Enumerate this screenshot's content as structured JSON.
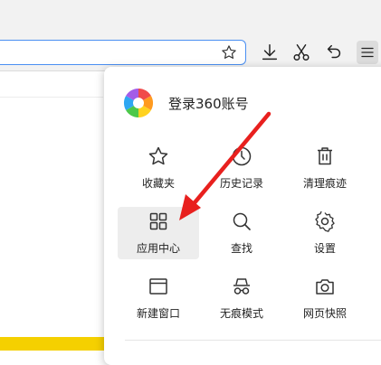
{
  "menu": {
    "login_label": "登录360账号",
    "items": [
      {
        "label": "收藏夹",
        "icon": "star-icon"
      },
      {
        "label": "历史记录",
        "icon": "clock-icon"
      },
      {
        "label": "清理痕迹",
        "icon": "trash-icon"
      },
      {
        "label": "应用中心",
        "icon": "grid-icon"
      },
      {
        "label": "查找",
        "icon": "search-icon"
      },
      {
        "label": "设置",
        "icon": "gear-icon"
      },
      {
        "label": "新建窗口",
        "icon": "window-icon"
      },
      {
        "label": "无痕模式",
        "icon": "incognito-icon"
      },
      {
        "label": "网页快照",
        "icon": "camera-icon"
      }
    ]
  },
  "colors": {
    "address_border": "#4a8ff2",
    "annotation_arrow": "#e8201e",
    "page_banner": "#f5d000"
  }
}
